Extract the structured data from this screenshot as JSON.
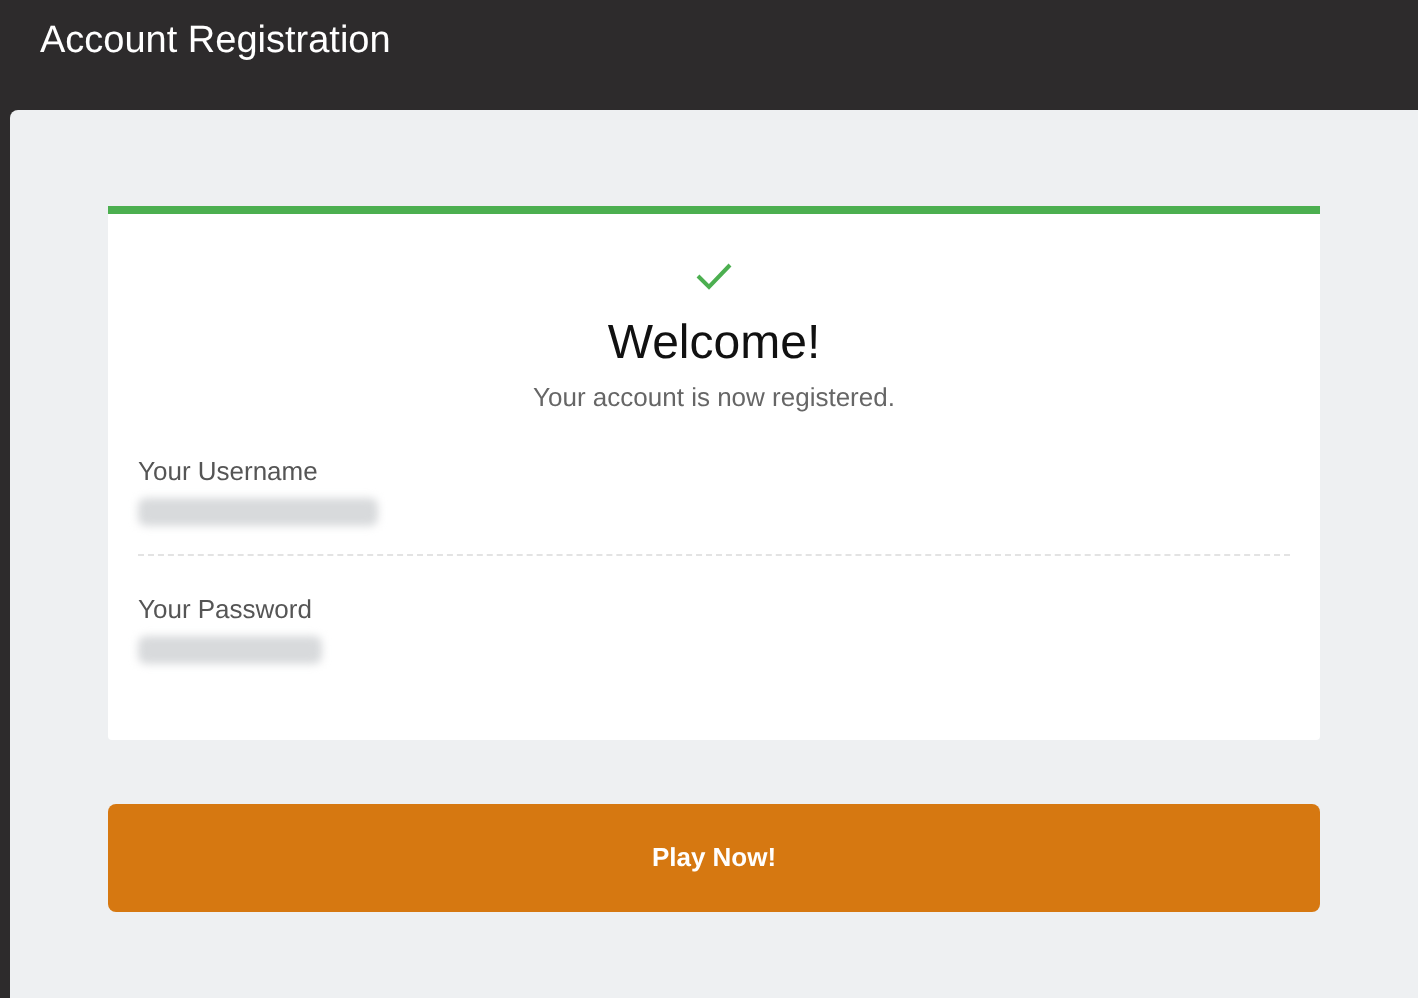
{
  "window": {
    "title": "Account Registration"
  },
  "card": {
    "heading": "Welcome!",
    "message": "Your account is now registered.",
    "fields": [
      {
        "label": "Your Username"
      },
      {
        "label": "Your Password"
      }
    ]
  },
  "button": {
    "label": "Play Now!"
  }
}
